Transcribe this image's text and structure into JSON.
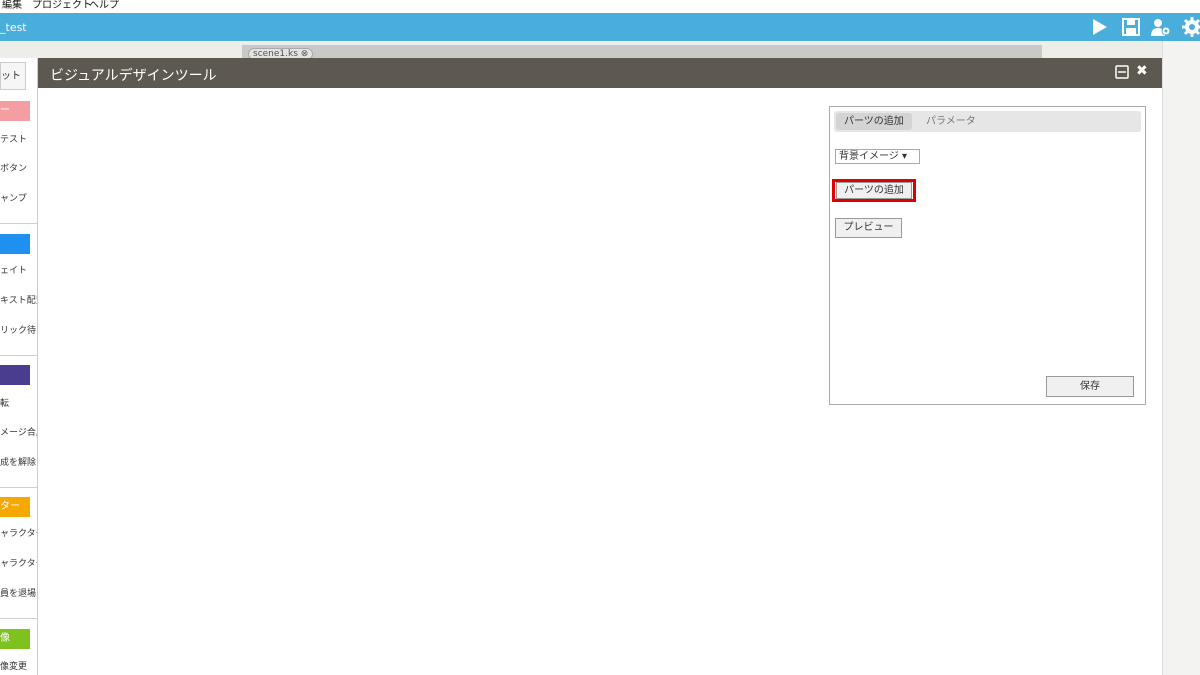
{
  "menu": [
    "編集",
    "プロジェクト",
    "ヘルプ"
  ],
  "app": {
    "title": "_test"
  },
  "editor": {
    "file_tab": "scene1.ks ⊗"
  },
  "sidebar": {
    "tab_label": "ット",
    "categories": [
      {
        "label": "ー",
        "color": "#f49ea1",
        "items": [
          "テスト",
          "ボタン",
          "ャンプ"
        ]
      },
      {
        "label": "",
        "color": "#1f8ff0",
        "items": [
          "ェイト",
          "キスト配置",
          "リック待ち"
        ]
      },
      {
        "label": "",
        "color": "#4a3d8f",
        "items": [
          "転",
          "メージ合成",
          "成を解除"
        ]
      },
      {
        "label": "ター",
        "color": "#f5a800",
        "items": [
          "ャラクター",
          "ャラクター",
          "員を退場"
        ]
      },
      {
        "label": "像",
        "color": "#7ec21f",
        "items": [
          "像変更"
        ]
      }
    ]
  },
  "window": {
    "title": "ビジュアルデザインツール"
  },
  "panel": {
    "tabs": [
      "パーツの追加",
      "パラメータ"
    ],
    "select_value": "背景イメージ ▾",
    "add_part_label": "パーツの追加",
    "preview_label": "プレビュー",
    "save_label": "保存"
  },
  "colors": {
    "titlebar": "#4aaedd",
    "window_header": "#5e5950",
    "highlight": "#e10000"
  }
}
